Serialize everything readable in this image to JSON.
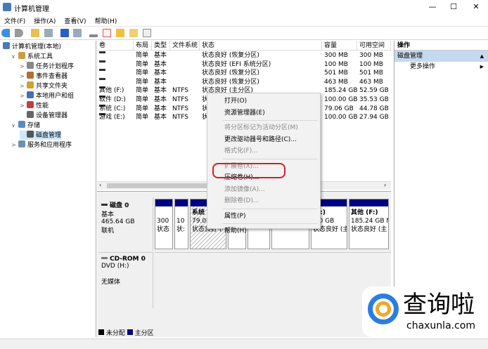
{
  "window": {
    "title": "计算机管理",
    "minimize": "—",
    "maximize": "☐",
    "close": "✕"
  },
  "menu": [
    "文件(F)",
    "操作(A)",
    "查看(V)",
    "帮助(H)"
  ],
  "tree": [
    {
      "label": "计算机管理(本地)",
      "icon": "computer-management-icon",
      "indent": 0,
      "arrow": ""
    },
    {
      "label": "系统工具",
      "icon": "tools-icon",
      "indent": 1,
      "arrow": "∨"
    },
    {
      "label": "任务计划程序",
      "icon": "clock-icon",
      "indent": 2,
      "arrow": ">"
    },
    {
      "label": "事件查看器",
      "icon": "event-viewer-icon",
      "indent": 2,
      "arrow": ">"
    },
    {
      "label": "共享文件夹",
      "icon": "shared-folder-icon",
      "indent": 2,
      "arrow": ">"
    },
    {
      "label": "本地用户和组",
      "icon": "users-icon",
      "indent": 2,
      "arrow": ">"
    },
    {
      "label": "性能",
      "icon": "performance-icon",
      "indent": 2,
      "arrow": ">"
    },
    {
      "label": "设备管理器",
      "icon": "device-manager-icon",
      "indent": 2,
      "arrow": ""
    },
    {
      "label": "存储",
      "icon": "storage-icon",
      "indent": 1,
      "arrow": "∨"
    },
    {
      "label": "磁盘管理",
      "icon": "disk-icon",
      "indent": 2,
      "arrow": "",
      "selected": true
    },
    {
      "label": "服务和应用程序",
      "icon": "services-icon",
      "indent": 1,
      "arrow": ">"
    }
  ],
  "columns": [
    "卷",
    "布局",
    "类型",
    "文件系统",
    "状态",
    "容量",
    "可用空间"
  ],
  "rows": [
    [
      "",
      "简单",
      "基本",
      "",
      "状态良好 (恢复分区)",
      "300 MB",
      "300 MB"
    ],
    [
      "",
      "简单",
      "基本",
      "",
      "状态良好 (EFI 系统分区)",
      "100 MB",
      "100 MB"
    ],
    [
      "",
      "简单",
      "基本",
      "",
      "状态良好 (恢复分区)",
      "501 MB",
      "501 MB"
    ],
    [
      "",
      "简单",
      "基本",
      "",
      "状态良好 (恢复分区)",
      "463 MB",
      "463 MB"
    ],
    [
      "其他 (F:)",
      "简单",
      "基本",
      "NTFS",
      "状态良好 (主分区)",
      "185.24 GB",
      "52.59 GB"
    ],
    [
      "软件 (D:)",
      "简单",
      "基本",
      "NTFS",
      "状",
      "100.00 GB",
      "35.53 GB"
    ],
    [
      "系统 (C:)",
      "简单",
      "基本",
      "NTFS",
      "状",
      "79.06 GB",
      "44.78 GB"
    ],
    [
      "游戏 (E:)",
      "简单",
      "基本",
      "NTFS",
      "状",
      "100.00 GB",
      "27.94 GB"
    ]
  ],
  "disk0": {
    "name": "磁盘 0",
    "type": "基本",
    "size": "465.64 GB",
    "status": "联机",
    "partitions": [
      {
        "title": "",
        "l1": "300",
        "l2": "状态"
      },
      {
        "title": "",
        "l1": "10",
        "l2": "状:"
      },
      {
        "title": "系统",
        "l1": "79.06",
        "l2": "状态良好 (",
        "hatch": true
      },
      {
        "title": "",
        "l1": "",
        "l2": "状态"
      },
      {
        "title": "",
        "l1": "",
        "l2": "状态"
      },
      {
        "title": "",
        "l1": "",
        "l2": "状态良好 (E"
      },
      {
        "title": "(E:)",
        "l1": ".00 GB",
        "l2": "状态良好 (主"
      },
      {
        "title": "其他  (F:)",
        "l1": "185.24 GB N",
        "l2": "状态良好 (主"
      }
    ]
  },
  "cdrom": {
    "name": "CD-ROM 0",
    "type": "DVD (H:)",
    "status": "无媒体"
  },
  "legend": [
    {
      "label": "未分配",
      "color": "#000000"
    },
    {
      "label": "主分区",
      "color": "#000080"
    }
  ],
  "actions": {
    "header": "操作",
    "section": "磁盘管理",
    "more": "更多操作"
  },
  "context_menu": [
    {
      "label": "打开(O)",
      "enabled": true
    },
    {
      "label": "资源管理器(E)",
      "enabled": true
    },
    {
      "sep": true
    },
    {
      "label": "将分区标记为活动分区(M)",
      "enabled": false
    },
    {
      "label": "更改驱动器号和路径(C)...",
      "enabled": true
    },
    {
      "label": "格式化(F)...",
      "enabled": false
    },
    {
      "sep": true
    },
    {
      "label": "扩展卷(X)...",
      "enabled": false
    },
    {
      "label": "压缩卷(H)...",
      "enabled": true,
      "highlighted": true
    },
    {
      "label": "添加镜像(A)...",
      "enabled": false
    },
    {
      "label": "删除卷(D)...",
      "enabled": false
    },
    {
      "sep": true
    },
    {
      "label": "属性(P)",
      "enabled": true
    },
    {
      "sep": true
    },
    {
      "label": "帮助(H)",
      "enabled": true
    }
  ],
  "watermark": {
    "text": "查询啦",
    "url": "chaxunla.com"
  },
  "colors": {
    "primary_partition": "#000080",
    "selection": "#cce8ff",
    "highlight_circle": "#d0202a",
    "action_header": "#c5d9ee"
  }
}
